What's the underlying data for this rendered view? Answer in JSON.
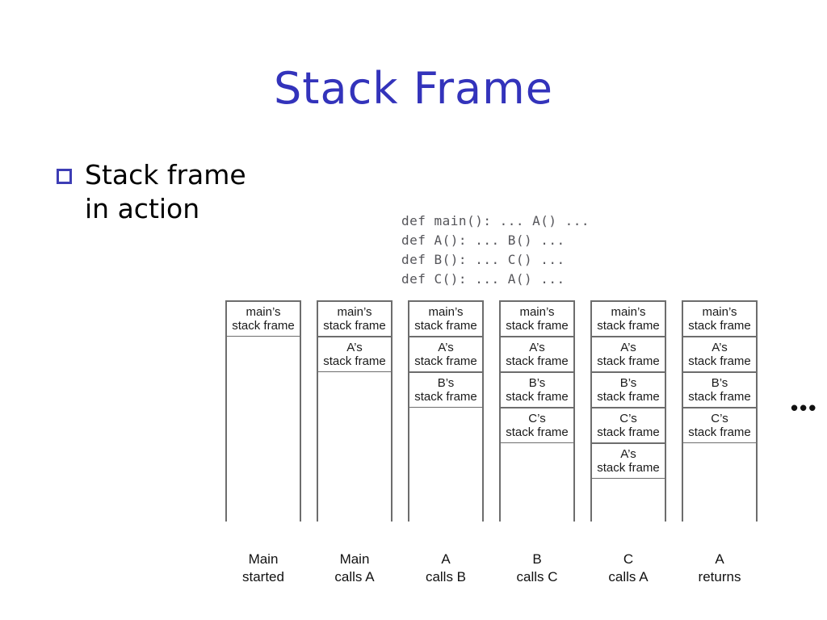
{
  "slide": {
    "title": "Stack Frame",
    "title_color": "#3333bb",
    "bullet_text": "Stack frame\nin action",
    "bullet_marker_color": "#3d3db5"
  },
  "code": {
    "listing": "def main(): ... A() ...\ndef A(): ... B() ...\ndef B(): ... C() ...\ndef C(): ... A() ..."
  },
  "diagram": {
    "frame_suffix": "stack frame",
    "ellipsis": "•••",
    "columns": [
      {
        "caption": "Main\nstarted",
        "frames": [
          {
            "owner": "main’s",
            "sub": "stack frame"
          }
        ]
      },
      {
        "caption": "Main\ncalls A",
        "frames": [
          {
            "owner": "main’s",
            "sub": "stack frame"
          },
          {
            "owner": "A’s",
            "sub": "stack frame"
          }
        ]
      },
      {
        "caption": "A\ncalls B",
        "frames": [
          {
            "owner": "main’s",
            "sub": "stack frame"
          },
          {
            "owner": "A’s",
            "sub": "stack frame"
          },
          {
            "owner": "B’s",
            "sub": "stack frame"
          }
        ]
      },
      {
        "caption": "B\ncalls C",
        "frames": [
          {
            "owner": "main’s",
            "sub": "stack frame"
          },
          {
            "owner": "A’s",
            "sub": "stack frame"
          },
          {
            "owner": "B’s",
            "sub": "stack frame"
          },
          {
            "owner": "C’s",
            "sub": "stack frame"
          }
        ]
      },
      {
        "caption": "C\ncalls A",
        "frames": [
          {
            "owner": "main’s",
            "sub": "stack frame"
          },
          {
            "owner": "A’s",
            "sub": "stack frame"
          },
          {
            "owner": "B’s",
            "sub": "stack frame"
          },
          {
            "owner": "C’s",
            "sub": "stack frame"
          },
          {
            "owner": "A’s",
            "sub": "stack frame"
          }
        ]
      },
      {
        "caption": "A\nreturns",
        "frames": [
          {
            "owner": "main’s",
            "sub": "stack frame"
          },
          {
            "owner": "A’s",
            "sub": "stack frame"
          },
          {
            "owner": "B’s",
            "sub": "stack frame"
          },
          {
            "owner": "C’s",
            "sub": "stack frame"
          }
        ]
      }
    ]
  }
}
